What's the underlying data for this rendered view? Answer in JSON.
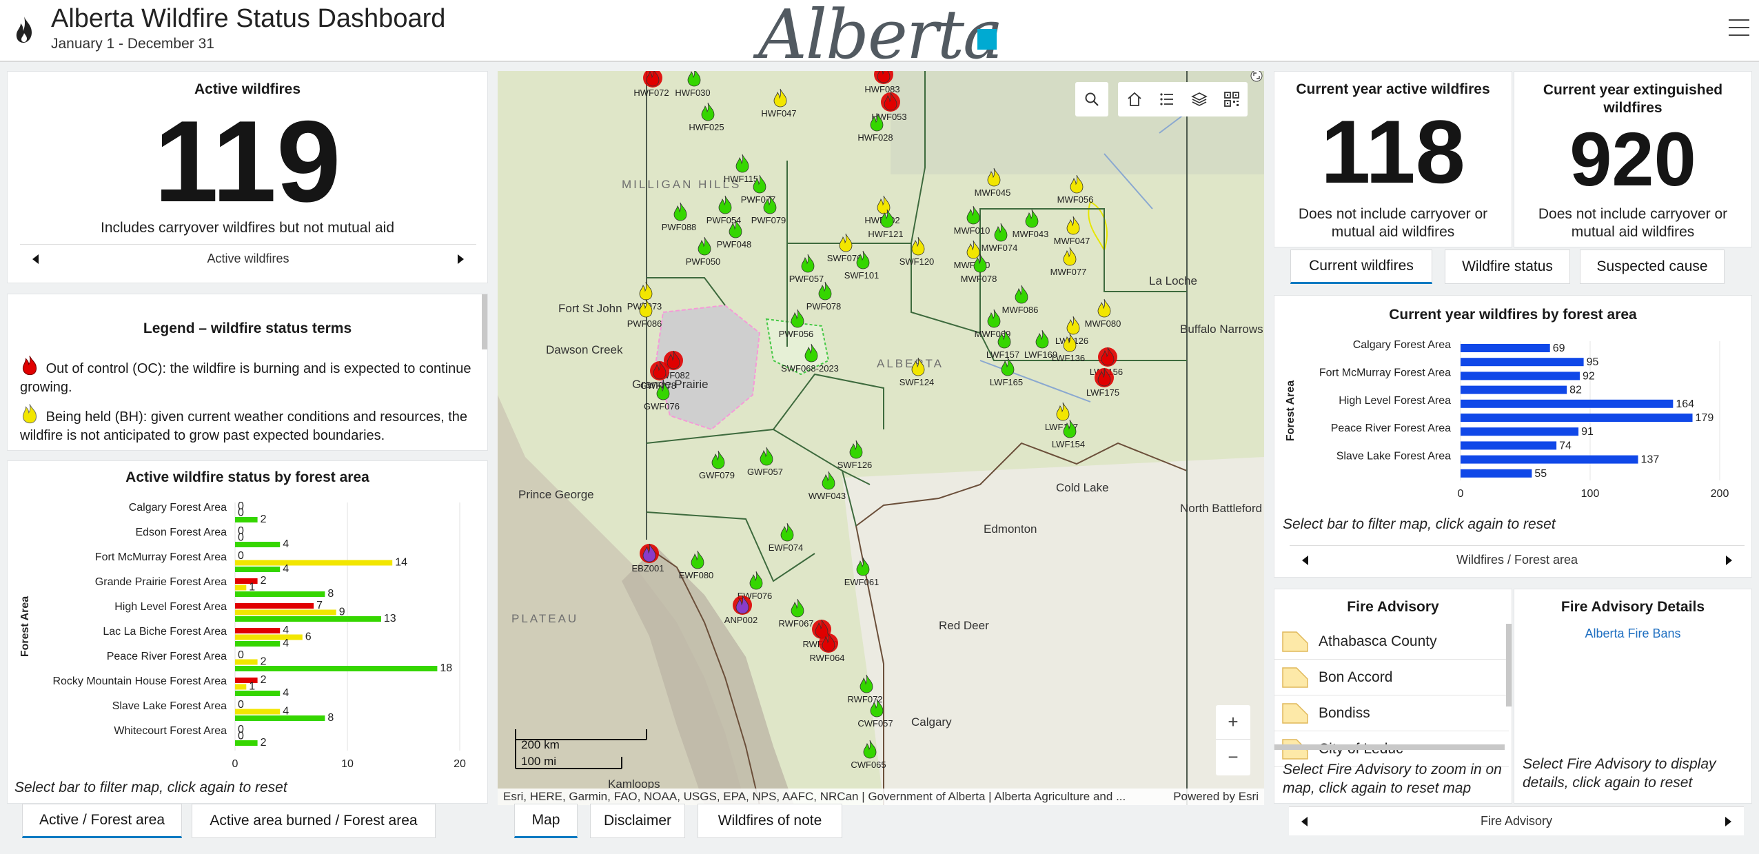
{
  "header": {
    "title": "Alberta Wildfire Status Dashboard",
    "date_range": "January 1 - December 31",
    "logo_text": "Alberta"
  },
  "active": {
    "title": "Active wildfires",
    "count": "119",
    "description": "Includes carryover wildfires but not mutual aid",
    "pager_label": "Active wildfires"
  },
  "legend": {
    "title": "Legend – wildfire status terms",
    "items": [
      {
        "text": "Out of control (OC): the wildfire is burning and is expected to continue growing.",
        "color": "#e00000"
      },
      {
        "text": "Being held (BH): given current weather conditions and resources, the wildfire is not anticipated to grow past expected boundaries.",
        "color": "#f2e600"
      }
    ]
  },
  "status_chart": {
    "title": "Active wildfire status by forest area",
    "note": "Select bar to filter map, click again to reset",
    "chart_data": {
      "type": "bar",
      "orientation": "horizontal",
      "ylabel": "Forest Area",
      "xlim": [
        0,
        20
      ],
      "xticks": [
        "0",
        "10",
        "20"
      ],
      "categories": [
        "Calgary Forest Area",
        "Edson Forest Area",
        "Fort McMurray Forest Area",
        "Grande Prairie Forest Area",
        "High Level Forest Area",
        "Lac La Biche Forest Area",
        "Peace River Forest Area",
        "Rocky Mountain House Forest Area",
        "Slave Lake Forest Area",
        "Whitecourt Forest Area"
      ],
      "series": [
        {
          "color": "#e00000",
          "values": [
            0,
            0,
            0,
            2,
            7,
            4,
            0,
            2,
            0,
            0
          ]
        },
        {
          "color": "#f2e600",
          "values": [
            0,
            0,
            14,
            1,
            9,
            6,
            2,
            1,
            4,
            0
          ]
        },
        {
          "color": "#35d600",
          "values": [
            2,
            4,
            4,
            8,
            13,
            4,
            18,
            4,
            8,
            2
          ]
        }
      ],
      "grid": true
    }
  },
  "left_tabs": [
    "Active / Forest area",
    "Active area burned / Forest area"
  ],
  "map": {
    "attribution": "Esri, HERE, Garmin, FAO, NOAA, USGS, EPA, NPS, AAFC, NRCan | Government of Alberta | Alberta Agriculture and ...",
    "powered": "Powered by Esri",
    "scale_km": "200 km",
    "scale_mi": "100 mi",
    "places": [
      "Fort St John",
      "Dawson Creek",
      "Prince George",
      "Edmonton",
      "Red Deer",
      "Calgary",
      "La Loche",
      "Buffalo Narrows",
      "North Battleford",
      "Cold Lake",
      "Kamloops",
      "ALBERTA",
      "PLATEAU",
      "MILLIGAN HILLS",
      "Grande Prairie"
    ],
    "fires": [
      {
        "id": "HWF072",
        "s": "oc"
      },
      {
        "id": "HWF030",
        "s": "uc"
      },
      {
        "id": "HWF025",
        "s": "uc"
      },
      {
        "id": "HWF047",
        "s": "bh"
      },
      {
        "id": "HWF083",
        "s": "oc"
      },
      {
        "id": "HWF053",
        "s": "oc"
      },
      {
        "id": "HWF028",
        "s": "uc"
      },
      {
        "id": "HWF115",
        "s": "uc"
      },
      {
        "id": "PWF077",
        "s": "uc"
      },
      {
        "id": "PWF088",
        "s": "uc"
      },
      {
        "id": "PWF054",
        "s": "uc"
      },
      {
        "id": "PWF079",
        "s": "uc"
      },
      {
        "id": "PWF048",
        "s": "uc"
      },
      {
        "id": "PWF050",
        "s": "uc"
      },
      {
        "id": "PWF073",
        "s": "bh"
      },
      {
        "id": "PWF086",
        "s": "bh"
      },
      {
        "id": "PWF057",
        "s": "uc"
      },
      {
        "id": "PWF078",
        "s": "uc"
      },
      {
        "id": "PWF056",
        "s": "uc"
      },
      {
        "id": "HWF102",
        "s": "bh"
      },
      {
        "id": "HWF121",
        "s": "uc"
      },
      {
        "id": "SWF076",
        "s": "bh"
      },
      {
        "id": "SWF101",
        "s": "uc"
      },
      {
        "id": "SWF120",
        "s": "bh"
      },
      {
        "id": "MWF010",
        "s": "uc"
      },
      {
        "id": "MWF045",
        "s": "bh"
      },
      {
        "id": "MWF074",
        "s": "uc"
      },
      {
        "id": "MWF060",
        "s": "bh"
      },
      {
        "id": "MWF078",
        "s": "uc"
      },
      {
        "id": "MWF043",
        "s": "uc"
      },
      {
        "id": "MWF056",
        "s": "bh"
      },
      {
        "id": "MWF047",
        "s": "bh"
      },
      {
        "id": "MWF077",
        "s": "bh"
      },
      {
        "id": "MWF080",
        "s": "bh"
      },
      {
        "id": "MWF086",
        "s": "uc"
      },
      {
        "id": "MWF069",
        "s": "uc"
      },
      {
        "id": "LWF126",
        "s": "bh"
      },
      {
        "id": "LWF157",
        "s": "uc"
      },
      {
        "id": "LWF169",
        "s": "uc"
      },
      {
        "id": "LWF136",
        "s": "bh"
      },
      {
        "id": "LWF156",
        "s": "oc"
      },
      {
        "id": "LWF175",
        "s": "oc"
      },
      {
        "id": "LWF165",
        "s": "uc"
      },
      {
        "id": "LWF147",
        "s": "bh"
      },
      {
        "id": "LWF154",
        "s": "uc"
      },
      {
        "id": "SWF124",
        "s": "bh"
      },
      {
        "id": "SWF068-2023",
        "s": "uc"
      },
      {
        "id": "GWF082",
        "s": "oc"
      },
      {
        "id": "GWF078",
        "s": "oc"
      },
      {
        "id": "GWF076",
        "s": "uc"
      },
      {
        "id": "GWF079",
        "s": "uc"
      },
      {
        "id": "GWF057",
        "s": "uc"
      },
      {
        "id": "SWF126",
        "s": "uc"
      },
      {
        "id": "WWF043",
        "s": "uc"
      },
      {
        "id": "EWF074",
        "s": "uc"
      },
      {
        "id": "EWF080",
        "s": "uc"
      },
      {
        "id": "EWF061",
        "s": "uc"
      },
      {
        "id": "EBZ001",
        "s": "ma"
      },
      {
        "id": "EWF076",
        "s": "uc"
      },
      {
        "id": "ANP002",
        "s": "ma"
      },
      {
        "id": "RWF067",
        "s": "uc"
      },
      {
        "id": "RWF060",
        "s": "oc"
      },
      {
        "id": "RWF064",
        "s": "oc"
      },
      {
        "id": "RWF072",
        "s": "uc"
      },
      {
        "id": "CWF057",
        "s": "uc"
      },
      {
        "id": "CWF065",
        "s": "uc"
      }
    ]
  },
  "center_tabs": [
    "Map",
    "Disclaimer",
    "Wildfires of note"
  ],
  "current_year": {
    "title": "Current year active wildfires",
    "count": "118",
    "description": "Does not include carryover or mutual aid wildfires"
  },
  "extinguished": {
    "title": "Current year extinguished wildfires",
    "count": "920",
    "description": "Does not include carryover or mutual aid wildfires"
  },
  "right_tabs": [
    "Current wildfires",
    "Wildfire status",
    "Suspected cause"
  ],
  "forest_chart": {
    "title": "Current year wildfires by forest area",
    "note": "Select bar to filter map, click again to reset",
    "pager_label": "Wildfires / Forest area",
    "chart_data": {
      "type": "bar",
      "orientation": "horizontal",
      "ylabel": "Forest Area",
      "xlim": [
        0,
        200
      ],
      "xticks": [
        "0",
        "100",
        "200"
      ],
      "categories": [
        "Calgary Forest Area",
        "",
        "Fort McMurray Forest Area",
        "",
        "High Level Forest Area",
        "",
        "Peace River Forest Area",
        "",
        "Slave Lake Forest Area",
        ""
      ],
      "values": [
        69,
        95,
        92,
        82,
        164,
        179,
        91,
        74,
        137,
        55
      ],
      "color": "#1048e8"
    }
  },
  "advisory": {
    "title": "Fire Advisory",
    "items": [
      "Athabasca County",
      "Bon Accord",
      "Bondiss",
      "City of Leduc"
    ],
    "note": "Select Fire Advisory to zoom in on map, click again to reset map"
  },
  "advisory_details": {
    "title": "Fire Advisory Details",
    "link": "Alberta Fire Bans",
    "note": "Select Fire Advisory to display details, click again to reset",
    "pager_label": "Fire Advisory"
  }
}
